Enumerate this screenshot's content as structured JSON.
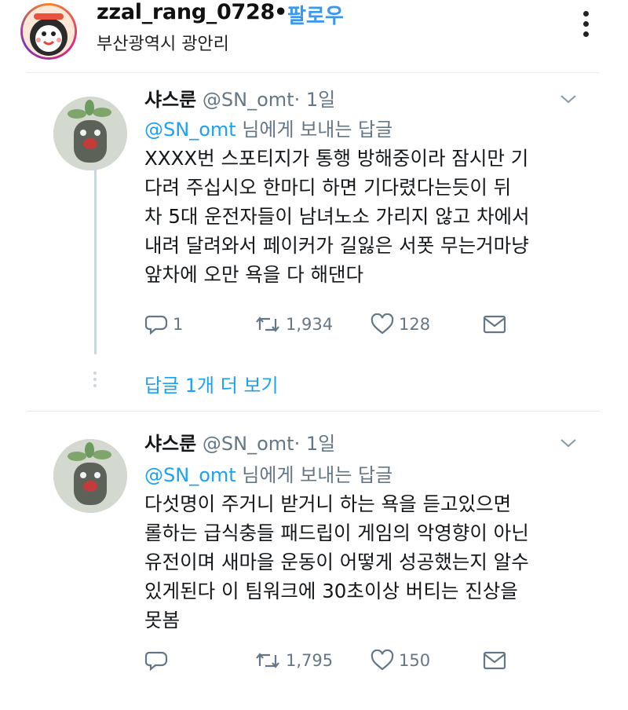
{
  "header": {
    "username": "zzal_rang_0728",
    "separator": "•",
    "follow_label": "팔로우",
    "location": "부산광역시 광안리",
    "more_icon": "more-vertical-icon"
  },
  "tweets": [
    {
      "name": "샤스룬",
      "handle": "@SN_omt",
      "time": "· 1일",
      "reply_mention": "@SN_omt",
      "reply_suffix": " 님에게 보내는 답글",
      "lines": [
        "XXXX번 스포티지가 통행 방해중이라 잠시만 기",
        "다려 주십시오 한마디 하면 기다렸다는듯이 뒤",
        "차 5대 운전자들이 남녀노소 가리지 않고 차에서",
        "내려 달려와서 페이커가 길잃은 서폿 무는거마냥",
        "앞차에 오만 욕을 다 해댄다"
      ],
      "replies": "1",
      "retweets": "1,934",
      "likes": "128"
    },
    {
      "name": "샤스룬",
      "handle": "@SN_omt",
      "time": "· 1일",
      "reply_mention": "@SN_omt",
      "reply_suffix": " 님에게 보내는 답글",
      "lines": [
        "다섯명이 주거니 받거니 하는 욕을 듣고있으면",
        "롤하는 급식충들 패드립이 게임의 악영향이 아닌",
        "유전이며 새마을 운동이 어떻게 성공했는지 알수",
        "있게된다 이 팀워크에 30초이상 버티는 진상을",
        "못봄"
      ],
      "replies": "",
      "retweets": "1,795",
      "likes": "150"
    }
  ],
  "more_replies_label": "답글 1개 더 보기",
  "colors": {
    "link": "#1da1f2",
    "muted": "#657786",
    "follow": "#3897f0"
  }
}
